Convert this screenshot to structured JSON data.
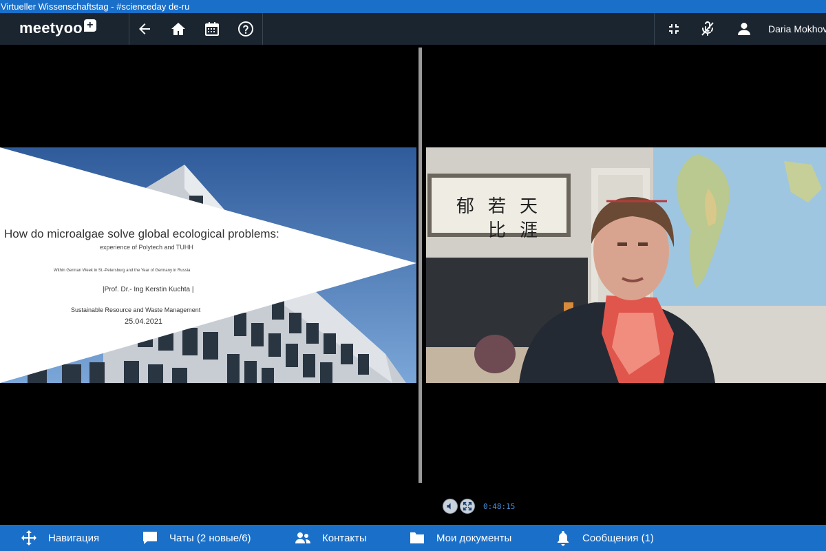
{
  "window": {
    "title": "Virtueller Wissenschaftstag - #scienceday de-ru"
  },
  "topbar": {
    "logo": "meetyoo",
    "logo_plus": "+",
    "user_name": "Daria Mokhova",
    "icons": [
      "arrow-left-icon",
      "home-icon",
      "calendar-icon",
      "help-icon",
      "fullscreen-exit-icon",
      "mic-off-icon",
      "user-icon"
    ]
  },
  "slide": {
    "title": "How do microalgae solve global ecological problems:",
    "subtitle": "experience of Polytech and TUHH",
    "context": "Within German Week in St.-Petersburg and the Year of Germany in Russia",
    "speaker": "|Prof. Dr.- Ing Kerstin Kuchta |",
    "department": "Sustainable Resource and Waste Management",
    "date": "25.04.2021"
  },
  "video": {
    "calligraphy": [
      "天",
      "若",
      "郁",
      "涯",
      "比"
    ]
  },
  "player": {
    "time": "0:48:15",
    "icons": [
      "volume-icon",
      "fullscreen-icon"
    ]
  },
  "bottombar": {
    "items": [
      {
        "label": "Навигация",
        "icon": "move-icon"
      },
      {
        "label": "Чаты (2 новые/6)",
        "icon": "chat-icon"
      },
      {
        "label": "Контакты",
        "icon": "contacts-icon"
      },
      {
        "label": "Мои документы",
        "icon": "folder-icon"
      },
      {
        "label": "Сообщения (1)",
        "icon": "bell-icon"
      }
    ]
  },
  "colors": {
    "brand_blue": "#1a6fc9",
    "topbar_dark": "#1b2530",
    "timer_blue": "#4a90d9"
  }
}
